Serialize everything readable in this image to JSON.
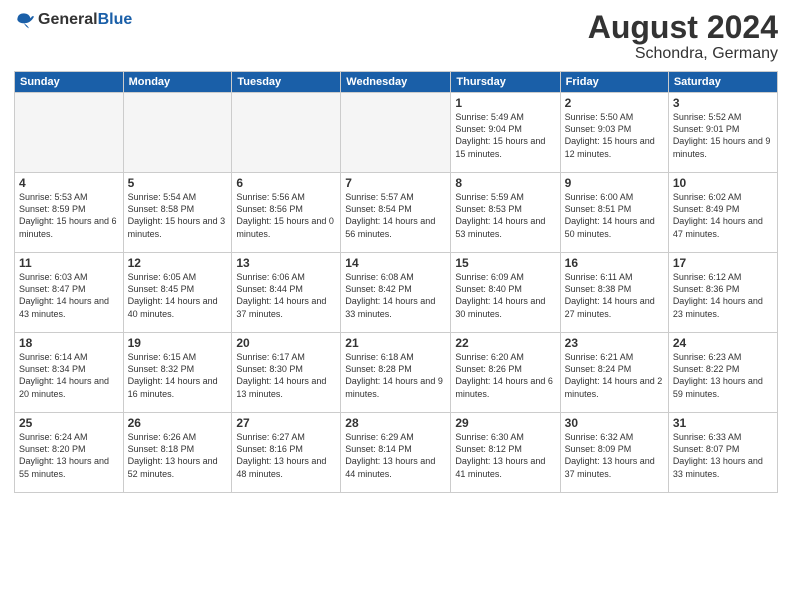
{
  "header": {
    "logo_general": "General",
    "logo_blue": "Blue",
    "month": "August 2024",
    "location": "Schondra, Germany"
  },
  "days_of_week": [
    "Sunday",
    "Monday",
    "Tuesday",
    "Wednesday",
    "Thursday",
    "Friday",
    "Saturday"
  ],
  "weeks": [
    [
      {
        "day": "",
        "empty": true
      },
      {
        "day": "",
        "empty": true
      },
      {
        "day": "",
        "empty": true
      },
      {
        "day": "",
        "empty": true
      },
      {
        "day": "1",
        "sunrise": "5:49 AM",
        "sunset": "9:04 PM",
        "daylight": "15 hours and 15 minutes."
      },
      {
        "day": "2",
        "sunrise": "5:50 AM",
        "sunset": "9:03 PM",
        "daylight": "15 hours and 12 minutes."
      },
      {
        "day": "3",
        "sunrise": "5:52 AM",
        "sunset": "9:01 PM",
        "daylight": "15 hours and 9 minutes."
      }
    ],
    [
      {
        "day": "4",
        "sunrise": "5:53 AM",
        "sunset": "8:59 PM",
        "daylight": "15 hours and 6 minutes."
      },
      {
        "day": "5",
        "sunrise": "5:54 AM",
        "sunset": "8:58 PM",
        "daylight": "15 hours and 3 minutes."
      },
      {
        "day": "6",
        "sunrise": "5:56 AM",
        "sunset": "8:56 PM",
        "daylight": "15 hours and 0 minutes."
      },
      {
        "day": "7",
        "sunrise": "5:57 AM",
        "sunset": "8:54 PM",
        "daylight": "14 hours and 56 minutes."
      },
      {
        "day": "8",
        "sunrise": "5:59 AM",
        "sunset": "8:53 PM",
        "daylight": "14 hours and 53 minutes."
      },
      {
        "day": "9",
        "sunrise": "6:00 AM",
        "sunset": "8:51 PM",
        "daylight": "14 hours and 50 minutes."
      },
      {
        "day": "10",
        "sunrise": "6:02 AM",
        "sunset": "8:49 PM",
        "daylight": "14 hours and 47 minutes."
      }
    ],
    [
      {
        "day": "11",
        "sunrise": "6:03 AM",
        "sunset": "8:47 PM",
        "daylight": "14 hours and 43 minutes."
      },
      {
        "day": "12",
        "sunrise": "6:05 AM",
        "sunset": "8:45 PM",
        "daylight": "14 hours and 40 minutes."
      },
      {
        "day": "13",
        "sunrise": "6:06 AM",
        "sunset": "8:44 PM",
        "daylight": "14 hours and 37 minutes."
      },
      {
        "day": "14",
        "sunrise": "6:08 AM",
        "sunset": "8:42 PM",
        "daylight": "14 hours and 33 minutes."
      },
      {
        "day": "15",
        "sunrise": "6:09 AM",
        "sunset": "8:40 PM",
        "daylight": "14 hours and 30 minutes."
      },
      {
        "day": "16",
        "sunrise": "6:11 AM",
        "sunset": "8:38 PM",
        "daylight": "14 hours and 27 minutes."
      },
      {
        "day": "17",
        "sunrise": "6:12 AM",
        "sunset": "8:36 PM",
        "daylight": "14 hours and 23 minutes."
      }
    ],
    [
      {
        "day": "18",
        "sunrise": "6:14 AM",
        "sunset": "8:34 PM",
        "daylight": "14 hours and 20 minutes."
      },
      {
        "day": "19",
        "sunrise": "6:15 AM",
        "sunset": "8:32 PM",
        "daylight": "14 hours and 16 minutes."
      },
      {
        "day": "20",
        "sunrise": "6:17 AM",
        "sunset": "8:30 PM",
        "daylight": "14 hours and 13 minutes."
      },
      {
        "day": "21",
        "sunrise": "6:18 AM",
        "sunset": "8:28 PM",
        "daylight": "14 hours and 9 minutes."
      },
      {
        "day": "22",
        "sunrise": "6:20 AM",
        "sunset": "8:26 PM",
        "daylight": "14 hours and 6 minutes."
      },
      {
        "day": "23",
        "sunrise": "6:21 AM",
        "sunset": "8:24 PM",
        "daylight": "14 hours and 2 minutes."
      },
      {
        "day": "24",
        "sunrise": "6:23 AM",
        "sunset": "8:22 PM",
        "daylight": "13 hours and 59 minutes."
      }
    ],
    [
      {
        "day": "25",
        "sunrise": "6:24 AM",
        "sunset": "8:20 PM",
        "daylight": "13 hours and 55 minutes."
      },
      {
        "day": "26",
        "sunrise": "6:26 AM",
        "sunset": "8:18 PM",
        "daylight": "13 hours and 52 minutes."
      },
      {
        "day": "27",
        "sunrise": "6:27 AM",
        "sunset": "8:16 PM",
        "daylight": "13 hours and 48 minutes."
      },
      {
        "day": "28",
        "sunrise": "6:29 AM",
        "sunset": "8:14 PM",
        "daylight": "13 hours and 44 minutes."
      },
      {
        "day": "29",
        "sunrise": "6:30 AM",
        "sunset": "8:12 PM",
        "daylight": "13 hours and 41 minutes."
      },
      {
        "day": "30",
        "sunrise": "6:32 AM",
        "sunset": "8:09 PM",
        "daylight": "13 hours and 37 minutes."
      },
      {
        "day": "31",
        "sunrise": "6:33 AM",
        "sunset": "8:07 PM",
        "daylight": "13 hours and 33 minutes."
      }
    ]
  ]
}
